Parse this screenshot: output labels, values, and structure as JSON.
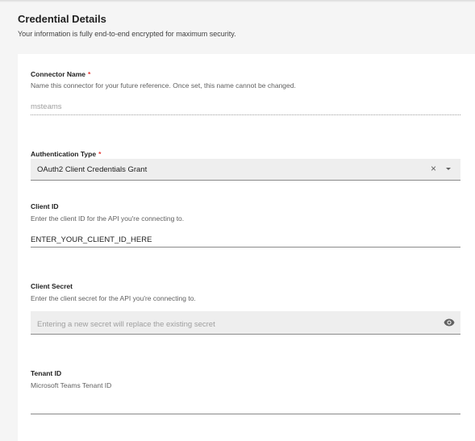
{
  "header": {
    "title": "Credential Details",
    "subtitle": "Your information is fully end-to-end encrypted for maximum security."
  },
  "connector_name": {
    "label": "Connector Name",
    "required_mark": "*",
    "help": "Name this connector for your future reference. Once set, this name cannot be changed.",
    "value": "msteams"
  },
  "auth_type": {
    "label": "Authentication Type",
    "required_mark": "*",
    "selected": "OAuth2 Client Credentials Grant",
    "clear_glyph": "×"
  },
  "client_id": {
    "label": "Client ID",
    "help": "Enter the client ID for the API you're connecting to.",
    "value": "ENTER_YOUR_CLIENT_ID_HERE"
  },
  "client_secret": {
    "label": "Client Secret",
    "help": "Enter the client secret for the API you're connecting to.",
    "placeholder": "Entering a new secret will replace the existing secret"
  },
  "tenant_id": {
    "label": "Tenant ID",
    "help": "Microsoft Teams Tenant ID",
    "value": ""
  },
  "icons": {
    "clear": "close-icon",
    "dropdown": "chevron-down-icon",
    "visibility": "eye-icon"
  },
  "colors": {
    "required": "#e53935",
    "field_fill": "#eeeeee",
    "page_bg": "#f5f5f5"
  }
}
